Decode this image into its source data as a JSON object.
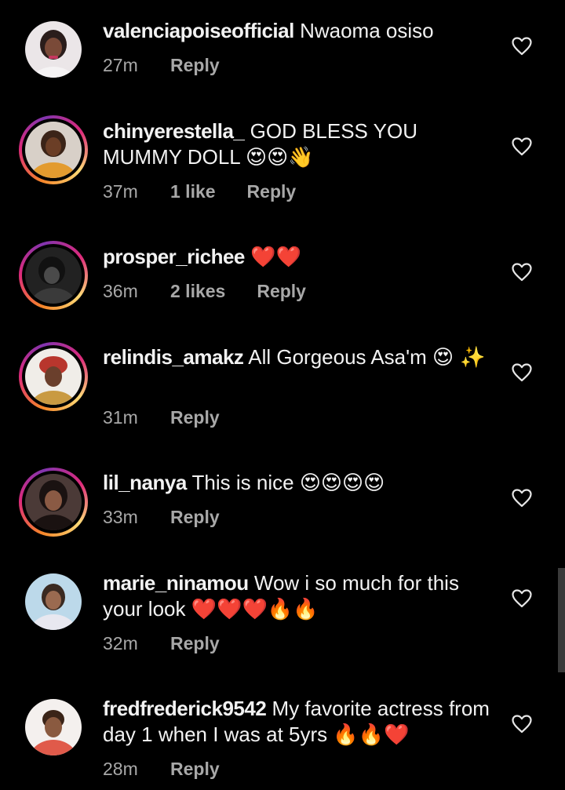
{
  "comments": [
    {
      "username": "valenciapoiseofficial",
      "text": "Nwaoma osiso",
      "emoji": "",
      "time": "27m",
      "likes": "",
      "reply": "Reply",
      "avatar_style": "plain",
      "avatar_colors": [
        "#e9e4e6",
        "#2a1d1b",
        "#c5375e"
      ]
    },
    {
      "username": "chinyerestella_",
      "text": "GOD BLESS YOU MUMMY DOLL",
      "emoji": "😍😍👋",
      "time": "37m",
      "likes": "1 like",
      "reply": "Reply",
      "avatar_style": "ring",
      "avatar_colors": [
        "#d8d0c8",
        "#3b2418",
        "#e39b2f"
      ]
    },
    {
      "username": "prosper_richee",
      "text": "",
      "emoji": "❤️❤️",
      "time": "36m",
      "likes": "2 likes",
      "reply": "Reply",
      "avatar_style": "ring",
      "avatar_colors": [
        "#1a1a1a",
        "#4a4a4a",
        "#2e2e2e"
      ]
    },
    {
      "username": "relindis_amakz",
      "text": "All Gorgeous Asa'm",
      "emoji": "😍 ✨",
      "time": "31m",
      "likes": "",
      "reply": "Reply",
      "avatar_style": "ring",
      "avatar_colors": [
        "#f0ede8",
        "#b8362d",
        "#c99a42"
      ]
    },
    {
      "username": "lil_nanya",
      "text": "This is nice",
      "emoji": "😍😍😍😍",
      "time": "33m",
      "likes": "",
      "reply": "Reply",
      "avatar_style": "ring",
      "avatar_colors": [
        "#4b3a37",
        "#1a1211",
        "#c08a70"
      ]
    },
    {
      "username": "marie_ninamou",
      "text": "Wow i so much for this your look",
      "emoji": "❤️❤️❤️🔥🔥",
      "time": "32m",
      "likes": "",
      "reply": "Reply",
      "avatar_style": "plain",
      "avatar_colors": [
        "#bcd9ea",
        "#e8e8f0",
        "#6a4a3a"
      ]
    },
    {
      "username": "fredfrederick9542",
      "text": "My favorite actress from day 1 when I was at 5yrs",
      "emoji": "🔥🔥❤️",
      "time": "28m",
      "likes": "",
      "reply": "Reply",
      "avatar_style": "plain",
      "avatar_colors": [
        "#f4f0ee",
        "#3a2418",
        "#e05a4a"
      ]
    }
  ]
}
